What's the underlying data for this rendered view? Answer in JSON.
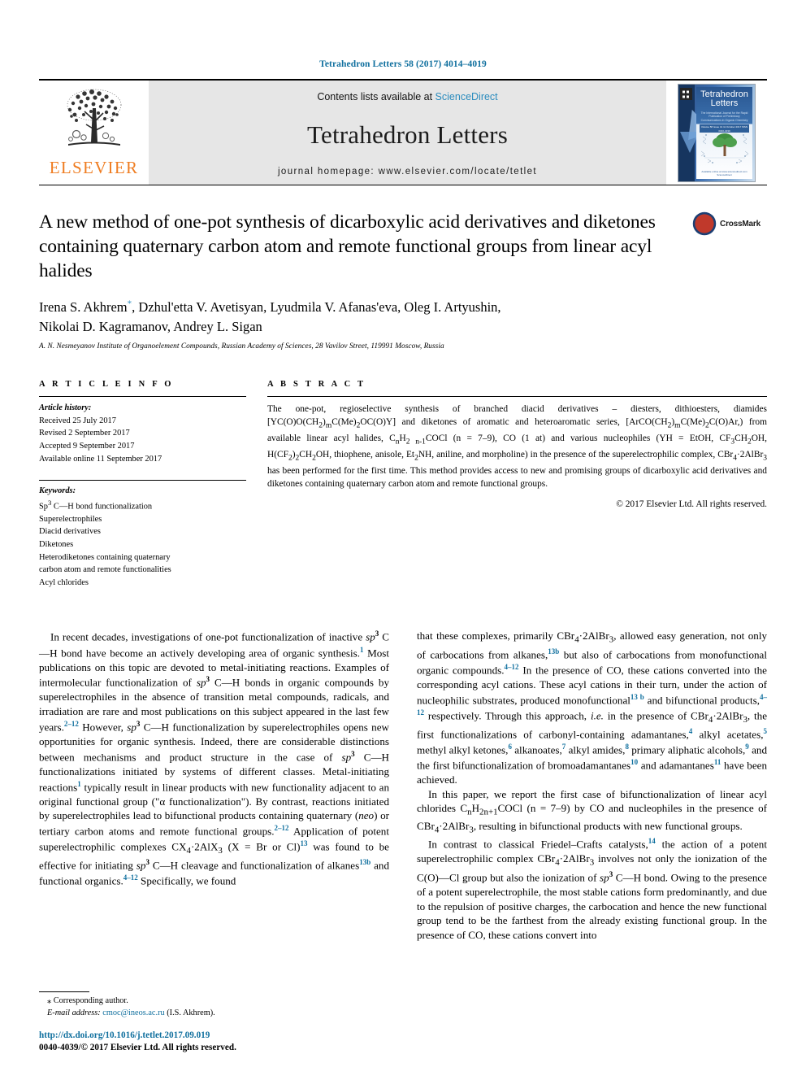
{
  "running_head": "Tetrahedron Letters 58 (2017) 4014–4019",
  "masthead": {
    "publisher": "ELSEVIER",
    "contents_prefix": "Contents lists available at ",
    "contents_link": "ScienceDirect",
    "journal_name": "Tetrahedron Letters",
    "homepage": "journal homepage: www.elsevier.com/locate/tetlet",
    "cover": {
      "title_line1": "Tetrahedron",
      "title_line2": "Letters",
      "subtitle": "The International Journal for the Rapid Publication of Preliminary Communications in Organic Chemistry",
      "band_text": "Volume 58 Issue 41 11 October 2017 ISSN 0040-4039",
      "footer": "Available online at www.sciencedirect.com  ScienceDirect"
    }
  },
  "article": {
    "title": "A new method of one-pot synthesis of dicarboxylic acid derivatives and diketones containing quaternary carbon atom and remote functional groups from linear acyl halides",
    "crossmark_label": "CrossMark",
    "authors_line1_pre": "Irena S. Akhrem",
    "authors_star": "*",
    "authors_line1_post": ", Dzhul'etta V. Avetisyan, Lyudmila V. Afanas'eva, Oleg I. Artyushin,",
    "authors_line2": "Nikolai D. Kagramanov, Andrey L. Sigan",
    "affiliation": "A. N. Nesmeyanov Institute of Organoelement Compounds, Russian Academy of Sciences, 28 Vavilov Street, 119991 Moscow, Russia"
  },
  "article_info": {
    "heading": "A R T I C L E  I N F O",
    "history_label": "Article history:",
    "history": [
      "Received 25 July 2017",
      "Revised 2 September 2017",
      "Accepted 9 September 2017",
      "Available online 11 September 2017"
    ],
    "keywords_label": "Keywords:",
    "keywords": [
      "Sp3 C—H bond functionalization",
      "Superelectrophiles",
      "Diacid derivatives",
      "Diketones",
      "Heterodiketones containing quaternary",
      "carbon atom and remote functionalities",
      "Acyl chlorides"
    ]
  },
  "abstract": {
    "heading": "A B S T R A C T",
    "text": "The one-pot, regioselective synthesis of branched diacid derivatives – diesters, dithioesters, diamides [YC(O)O(CH2)mC(Me)2OC(O)Y] and diketones of aromatic and heteroaromatic series, [ArCO(CH2)mC(Me)2C(O)Ar,) from available linear acyl halides, CnH2 n-1COCl (n = 7–9), CO (1 at) and various nucleophiles (YH = EtOH, CF3CH2OH, H(CF2)2CH2OH, thiophene, anisole, Et2NH, aniline, and morpholine) in the presence of the superelectrophilic complex, CBr4·2AlBr3 has been performed for the first time. This method provides access to new and promising groups of dicarboxylic acid derivatives and diketones containing quaternary carbon atom and remote functional groups.",
    "copyright": "© 2017 Elsevier Ltd. All rights reserved."
  },
  "body": {
    "left": [
      "In recent decades, investigations of one-pot functionalization of inactive sp3 C—H bond have become an actively developing area of organic synthesis.1 Most publications on this topic are devoted to metal-initiating reactions. Examples of intermolecular functionalization of sp3 C—H bonds in organic compounds by superelectrophiles in the absence of transition metal compounds, radicals, and irradiation are rare and most publications on this subject appeared in the last few years.2–12 However, sp3 C—H functionalization by superelectrophiles opens new opportunities for organic synthesis. Indeed, there are considerable distinctions between mechanisms and product structure in the case of sp3 C—H functionalizations initiated by systems of different classes. Metal-initiating reactions1 typically result in linear products with new functionality adjacent to an original functional group (\"α functionalization\"). By contrast, reactions initiated by superelectrophiles lead to bifunctional products containing quaternary (neo) or tertiary carbon atoms and remote functional groups.2–12 Application of potent superelectrophilic complexes CX4·2AlX3 (X = Br or Cl)13 was found to be effective for initiating sp3 C—H cleavage and functionalization of alkanes13b and functional organics.4–12 Specifically, we found"
    ],
    "right": [
      "that these complexes, primarily CBr4·2AlBr3, allowed easy generation, not only of carbocations from alkanes,13b but also of carbocations from monofunctional organic compounds.4–12 In the presence of CO, these cations converted into the corresponding acyl cations. These acyl cations in their turn, under the action of nucleophilic substrates, produced monofunctional13 b and bifunctional products,4–12 respectively. Through this approach, i.e. in the presence of CBr4·2AlBr3, the first functionalizations of carbonyl-containing adamantanes,4 alkyl acetates,5 methyl alkyl ketones,6 alkanoates,7 alkyl amides,8 primary aliphatic alcohols,9 and the first bifunctionalization of bromoadamantanes10 and adamantanes11 have been achieved.",
      "In this paper, we report the first case of bifunctionalization of linear acyl chlorides CnH2n+1COCl (n = 7–9) by CO and nucleophiles in the presence of CBr4·2AlBr3, resulting in bifunctional products with new functional groups.",
      "In contrast to classical Friedel–Crafts catalysts,14 the action of a potent superelectrophilic complex CBr4·2AlBr3 involves not only the ionization of the C(O)—Cl group but also the ionization of sp3 C—H bond. Owing to the presence of a potent superelectrophile, the most stable cations form predominantly, and due to the repulsion of positive charges, the carbocation and hence the new functional group tend to be the farthest from the already existing functional group. In the presence of CO, these cations convert into"
    ]
  },
  "footer": {
    "corresponding_marker": "⁎",
    "corresponding_label": "Corresponding author.",
    "email_label": "E-mail address:",
    "email": "cmoc@ineos.ac.ru",
    "email_owner": "(I.S. Akhrem).",
    "doi": "http://dx.doi.org/10.1016/j.tetlet.2017.09.019",
    "issn": "0040-4039/© 2017 Elsevier Ltd. All rights reserved."
  },
  "colors": {
    "link_blue": "#0f6f9e",
    "science_direct_blue": "#2b8cbe",
    "elsevier_orange": "#ef7d22",
    "masthead_gray": "#e6e6e6"
  }
}
